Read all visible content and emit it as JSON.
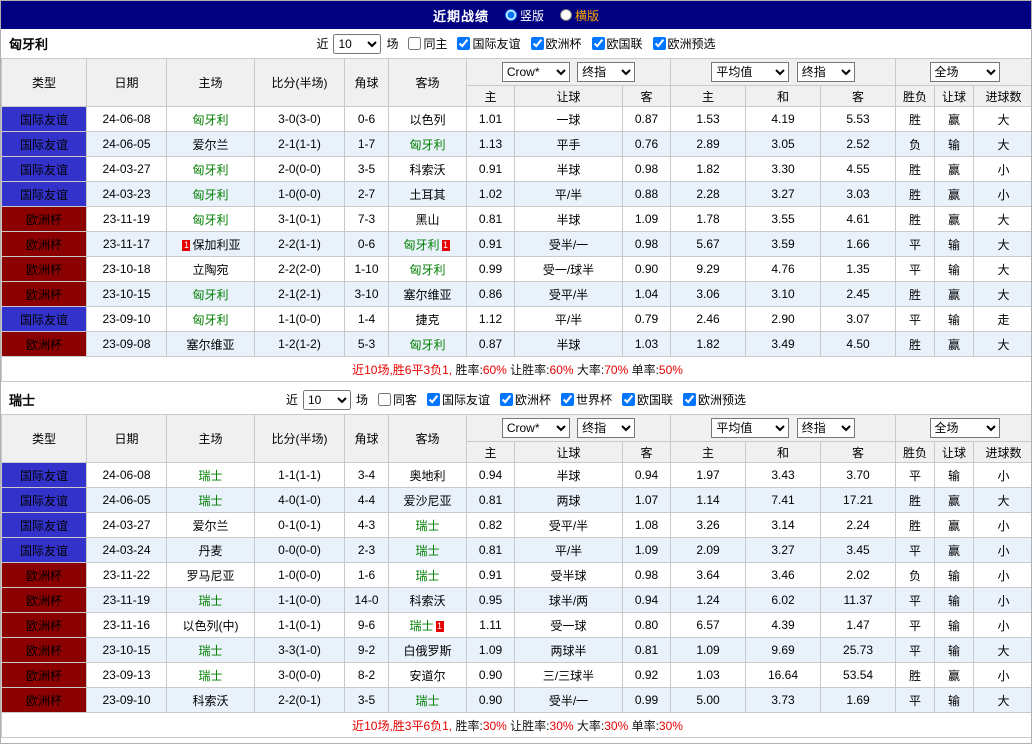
{
  "title_bar": {
    "title": "近期战绩",
    "vertical_label": "竖版",
    "horizontal_label": "横版"
  },
  "accents": {
    "title_bar_navy": "#000080",
    "friendly_blue": "#3333cc",
    "eurocup_darkred": "#8b0000",
    "win_red": "#e60000",
    "lose_blue": "#0000dd",
    "draw_green": "#008000",
    "loss_purple": "#800080",
    "alt_row_blue": "#e9f1fb",
    "horizontal_label_orange": "#ffa500"
  },
  "sections": [
    {
      "team": "匈牙利",
      "filter": {
        "prefix": "近",
        "count": "10",
        "suffix": "场",
        "checkboxes": [
          {
            "label": "同主",
            "checked": false
          },
          {
            "label": "国际友谊",
            "checked": true
          },
          {
            "label": "欧洲杯",
            "checked": true
          },
          {
            "label": "欧国联",
            "checked": true
          },
          {
            "label": "欧洲预选",
            "checked": true
          }
        ]
      },
      "header": {
        "static_cols": [
          "类型",
          "日期",
          "主场",
          "比分(半场)",
          "角球",
          "客场"
        ],
        "selects": [
          "Crow*",
          "终指",
          "平均值",
          "终指",
          "全场"
        ],
        "sub_cols": [
          "主",
          "让球",
          "客",
          "主",
          "和",
          "客",
          "胜负",
          "让球",
          "进球数"
        ]
      },
      "rows": [
        {
          "type": "国际友谊",
          "type_color": "blue",
          "date": "24-06-08",
          "home": "匈牙利",
          "home_green": true,
          "score": "3-0(3-0)",
          "corner": "0-6",
          "away": "以色列",
          "away_green": false,
          "odds_home": "1.01",
          "handicap": "一球",
          "odds_away": "0.87",
          "avg_home": "1.53",
          "avg_draw": "4.19",
          "avg_away": "5.53",
          "result": "胜",
          "result_color": "red",
          "let_result": "赢",
          "let_color": "red",
          "goals": "大",
          "goals_color": "red"
        },
        {
          "type": "国际友谊",
          "type_color": "blue",
          "date": "24-06-05",
          "home": "爱尔兰",
          "home_green": false,
          "score": "2-1(1-1)",
          "corner": "1-7",
          "away": "匈牙利",
          "away_green": true,
          "odds_home": "1.13",
          "handicap": "平手",
          "odds_away": "0.76",
          "avg_home": "2.89",
          "avg_draw": "3.05",
          "avg_away": "2.52",
          "result": "负",
          "result_color": "purple",
          "let_result": "输",
          "let_color": "blue",
          "goals": "大",
          "goals_color": "red"
        },
        {
          "type": "国际友谊",
          "type_color": "blue",
          "date": "24-03-27",
          "home": "匈牙利",
          "home_green": true,
          "score": "2-0(0-0)",
          "corner": "3-5",
          "away": "科索沃",
          "away_green": false,
          "odds_home": "0.91",
          "handicap": "半球",
          "odds_away": "0.98",
          "avg_home": "1.82",
          "avg_draw": "3.30",
          "avg_away": "4.55",
          "result": "胜",
          "result_color": "red",
          "let_result": "赢",
          "let_color": "red",
          "goals": "小",
          "goals_color": "blue"
        },
        {
          "type": "国际友谊",
          "type_color": "blue",
          "date": "24-03-23",
          "home": "匈牙利",
          "home_green": true,
          "score": "1-0(0-0)",
          "corner": "2-7",
          "away": "土耳其",
          "away_green": false,
          "odds_home": "1.02",
          "handicap": "平/半",
          "odds_away": "0.88",
          "avg_home": "2.28",
          "avg_draw": "3.27",
          "avg_away": "3.03",
          "result": "胜",
          "result_color": "red",
          "let_result": "赢",
          "let_color": "red",
          "goals": "小",
          "goals_color": "blue"
        },
        {
          "type": "欧洲杯",
          "type_color": "darkred",
          "date": "23-11-19",
          "home": "匈牙利",
          "home_green": true,
          "score": "3-1(0-1)",
          "corner": "7-3",
          "away": "黑山",
          "away_green": false,
          "odds_home": "0.81",
          "handicap": "半球",
          "odds_away": "1.09",
          "avg_home": "1.78",
          "avg_draw": "3.55",
          "avg_away": "4.61",
          "result": "胜",
          "result_color": "red",
          "let_result": "赢",
          "let_color": "red",
          "goals": "大",
          "goals_color": "red"
        },
        {
          "type": "欧洲杯",
          "type_color": "darkred",
          "date": "23-11-17",
          "home": "保加利亚",
          "home_green": false,
          "home_badge": "1",
          "home_badge_pos": "before",
          "score": "2-2(1-1)",
          "corner": "0-6",
          "away": "匈牙利",
          "away_green": true,
          "away_badge": "1",
          "away_badge_pos": "after",
          "odds_home": "0.91",
          "handicap": "受半/一",
          "odds_away": "0.98",
          "avg_home": "5.67",
          "avg_draw": "3.59",
          "avg_away": "1.66",
          "result": "平",
          "result_color": "green",
          "let_result": "输",
          "let_color": "blue",
          "goals": "大",
          "goals_color": "red"
        },
        {
          "type": "欧洲杯",
          "type_color": "darkred",
          "date": "23-10-18",
          "home": "立陶宛",
          "home_green": false,
          "score": "2-2(2-0)",
          "corner": "1-10",
          "away": "匈牙利",
          "away_green": true,
          "odds_home": "0.99",
          "handicap": "受一/球半",
          "odds_away": "0.90",
          "avg_home": "9.29",
          "avg_draw": "4.76",
          "avg_away": "1.35",
          "result": "平",
          "result_color": "green",
          "let_result": "输",
          "let_color": "blue",
          "goals": "大",
          "goals_color": "red"
        },
        {
          "type": "欧洲杯",
          "type_color": "darkred",
          "date": "23-10-15",
          "home": "匈牙利",
          "home_green": true,
          "score": "2-1(2-1)",
          "corner": "3-10",
          "away": "塞尔维亚",
          "away_green": false,
          "odds_home": "0.86",
          "handicap": "受平/半",
          "odds_away": "1.04",
          "avg_home": "3.06",
          "avg_draw": "3.10",
          "avg_away": "2.45",
          "result": "胜",
          "result_color": "red",
          "let_result": "赢",
          "let_color": "red",
          "goals": "大",
          "goals_color": "red"
        },
        {
          "type": "国际友谊",
          "type_color": "blue",
          "date": "23-09-10",
          "home": "匈牙利",
          "home_green": true,
          "score": "1-1(0-0)",
          "corner": "1-4",
          "away": "捷克",
          "away_green": false,
          "odds_home": "1.12",
          "handicap": "平/半",
          "odds_away": "0.79",
          "avg_home": "2.46",
          "avg_draw": "2.90",
          "avg_away": "3.07",
          "result": "平",
          "result_color": "green",
          "let_result": "输",
          "let_color": "blue",
          "goals": "走",
          "goals_color": "green"
        },
        {
          "type": "欧洲杯",
          "type_color": "darkred",
          "date": "23-09-08",
          "home": "塞尔维亚",
          "home_green": false,
          "score": "1-2(1-2)",
          "corner": "5-3",
          "away": "匈牙利",
          "away_green": true,
          "odds_home": "0.87",
          "handicap": "半球",
          "odds_away": "1.03",
          "avg_home": "1.82",
          "avg_draw": "3.49",
          "avg_away": "4.50",
          "result": "胜",
          "result_color": "red",
          "let_result": "赢",
          "let_color": "red",
          "goals": "大",
          "goals_color": "red"
        }
      ],
      "summary": [
        {
          "text": "近10场,胜6平3负1, ",
          "color": "red"
        },
        {
          "text": "胜率:",
          "color": "black"
        },
        {
          "text": "60%",
          "color": "red"
        },
        {
          "text": " 让胜率:",
          "color": "black"
        },
        {
          "text": "60%",
          "color": "red"
        },
        {
          "text": " 大率:",
          "color": "black"
        },
        {
          "text": "70%",
          "color": "red"
        },
        {
          "text": " 单率:",
          "color": "black"
        },
        {
          "text": "50%",
          "color": "red"
        }
      ]
    },
    {
      "team": "瑞士",
      "filter": {
        "prefix": "近",
        "count": "10",
        "suffix": "场",
        "checkboxes": [
          {
            "label": "同客",
            "checked": false
          },
          {
            "label": "国际友谊",
            "checked": true
          },
          {
            "label": "欧洲杯",
            "checked": true
          },
          {
            "label": "世界杯",
            "checked": true
          },
          {
            "label": "欧国联",
            "checked": true
          },
          {
            "label": "欧洲预选",
            "checked": true
          }
        ]
      },
      "header": {
        "static_cols": [
          "类型",
          "日期",
          "主场",
          "比分(半场)",
          "角球",
          "客场"
        ],
        "selects": [
          "Crow*",
          "终指",
          "平均值",
          "终指",
          "全场"
        ],
        "sub_cols": [
          "主",
          "让球",
          "客",
          "主",
          "和",
          "客",
          "胜负",
          "让球",
          "进球数"
        ]
      },
      "rows": [
        {
          "type": "国际友谊",
          "type_color": "blue",
          "date": "24-06-08",
          "home": "瑞士",
          "home_green": true,
          "score": "1-1(1-1)",
          "corner": "3-4",
          "away": "奥地利",
          "away_green": false,
          "odds_home": "0.94",
          "handicap": "半球",
          "odds_away": "0.94",
          "avg_home": "1.97",
          "avg_draw": "3.43",
          "avg_away": "3.70",
          "result": "平",
          "result_color": "green",
          "let_result": "输",
          "let_color": "blue",
          "goals": "小",
          "goals_color": "blue"
        },
        {
          "type": "国际友谊",
          "type_color": "blue",
          "date": "24-06-05",
          "home": "瑞士",
          "home_green": true,
          "score": "4-0(1-0)",
          "corner": "4-4",
          "away": "爱沙尼亚",
          "away_green": false,
          "odds_home": "0.81",
          "handicap": "两球",
          "odds_away": "1.07",
          "avg_home": "1.14",
          "avg_draw": "7.41",
          "avg_away": "17.21",
          "result": "胜",
          "result_color": "red",
          "let_result": "赢",
          "let_color": "red",
          "goals": "大",
          "goals_color": "red"
        },
        {
          "type": "国际友谊",
          "type_color": "blue",
          "date": "24-03-27",
          "home": "爱尔兰",
          "home_green": false,
          "score": "0-1(0-1)",
          "corner": "4-3",
          "away": "瑞士",
          "away_green": true,
          "odds_home": "0.82",
          "handicap": "受平/半",
          "odds_away": "1.08",
          "avg_home": "3.26",
          "avg_draw": "3.14",
          "avg_away": "2.24",
          "result": "胜",
          "result_color": "red",
          "let_result": "赢",
          "let_color": "red",
          "goals": "小",
          "goals_color": "blue"
        },
        {
          "type": "国际友谊",
          "type_color": "blue",
          "date": "24-03-24",
          "home": "丹麦",
          "home_green": false,
          "score": "0-0(0-0)",
          "corner": "2-3",
          "away": "瑞士",
          "away_green": true,
          "odds_home": "0.81",
          "handicap": "平/半",
          "odds_away": "1.09",
          "avg_home": "2.09",
          "avg_draw": "3.27",
          "avg_away": "3.45",
          "result": "平",
          "result_color": "green",
          "let_result": "赢",
          "let_color": "red",
          "goals": "小",
          "goals_color": "blue"
        },
        {
          "type": "欧洲杯",
          "type_color": "darkred",
          "date": "23-11-22",
          "home": "罗马尼亚",
          "home_green": false,
          "score": "1-0(0-0)",
          "corner": "1-6",
          "away": "瑞士",
          "away_green": true,
          "odds_home": "0.91",
          "handicap": "受半球",
          "odds_away": "0.98",
          "avg_home": "3.64",
          "avg_draw": "3.46",
          "avg_away": "2.02",
          "result": "负",
          "result_color": "purple",
          "let_result": "输",
          "let_color": "blue",
          "goals": "小",
          "goals_color": "blue"
        },
        {
          "type": "欧洲杯",
          "type_color": "darkred",
          "date": "23-11-19",
          "home": "瑞士",
          "home_green": true,
          "score": "1-1(0-0)",
          "corner": "14-0",
          "away": "科索沃",
          "away_green": false,
          "odds_home": "0.95",
          "handicap": "球半/两",
          "odds_away": "0.94",
          "avg_home": "1.24",
          "avg_draw": "6.02",
          "avg_away": "11.37",
          "result": "平",
          "result_color": "green",
          "let_result": "输",
          "let_color": "blue",
          "goals": "小",
          "goals_color": "blue"
        },
        {
          "type": "欧洲杯",
          "type_color": "darkred",
          "date": "23-11-16",
          "home": "以色列(中)",
          "home_green": false,
          "score": "1-1(0-1)",
          "corner": "9-6",
          "away": "瑞士",
          "away_green": true,
          "away_badge": "1",
          "away_badge_pos": "after",
          "odds_home": "1.11",
          "handicap": "受一球",
          "odds_away": "0.80",
          "avg_home": "6.57",
          "avg_draw": "4.39",
          "avg_away": "1.47",
          "result": "平",
          "result_color": "green",
          "let_result": "输",
          "let_color": "blue",
          "goals": "小",
          "goals_color": "blue"
        },
        {
          "type": "欧洲杯",
          "type_color": "darkred",
          "date": "23-10-15",
          "home": "瑞士",
          "home_green": true,
          "score": "3-3(1-0)",
          "corner": "9-2",
          "away": "白俄罗斯",
          "away_green": false,
          "odds_home": "1.09",
          "handicap": "两球半",
          "odds_away": "0.81",
          "avg_home": "1.09",
          "avg_draw": "9.69",
          "avg_away": "25.73",
          "result": "平",
          "result_color": "green",
          "let_result": "输",
          "let_color": "blue",
          "goals": "大",
          "goals_color": "red"
        },
        {
          "type": "欧洲杯",
          "type_color": "darkred",
          "date": "23-09-13",
          "home": "瑞士",
          "home_green": true,
          "score": "3-0(0-0)",
          "corner": "8-2",
          "away": "安道尔",
          "away_green": false,
          "odds_home": "0.90",
          "handicap": "三/三球半",
          "odds_away": "0.92",
          "avg_home": "1.03",
          "avg_draw": "16.64",
          "avg_away": "53.54",
          "result": "胜",
          "result_color": "red",
          "let_result": "赢",
          "let_color": "red",
          "goals": "小",
          "goals_color": "blue"
        },
        {
          "type": "欧洲杯",
          "type_color": "darkred",
          "date": "23-09-10",
          "home": "科索沃",
          "home_green": false,
          "score": "2-2(0-1)",
          "corner": "3-5",
          "away": "瑞士",
          "away_green": true,
          "odds_home": "0.90",
          "handicap": "受半/一",
          "odds_away": "0.99",
          "avg_home": "5.00",
          "avg_draw": "3.73",
          "avg_away": "1.69",
          "result": "平",
          "result_color": "green",
          "let_result": "输",
          "let_color": "blue",
          "goals": "大",
          "goals_color": "red"
        }
      ],
      "summary": [
        {
          "text": "近10场,胜3平6负1, ",
          "color": "red"
        },
        {
          "text": "胜率:",
          "color": "black"
        },
        {
          "text": "30%",
          "color": "red"
        },
        {
          "text": " 让胜率:",
          "color": "black"
        },
        {
          "text": "30%",
          "color": "red"
        },
        {
          "text": " 大率:",
          "color": "black"
        },
        {
          "text": "30%",
          "color": "red"
        },
        {
          "text": " 单率:",
          "color": "black"
        },
        {
          "text": "30%",
          "color": "red"
        }
      ]
    }
  ]
}
